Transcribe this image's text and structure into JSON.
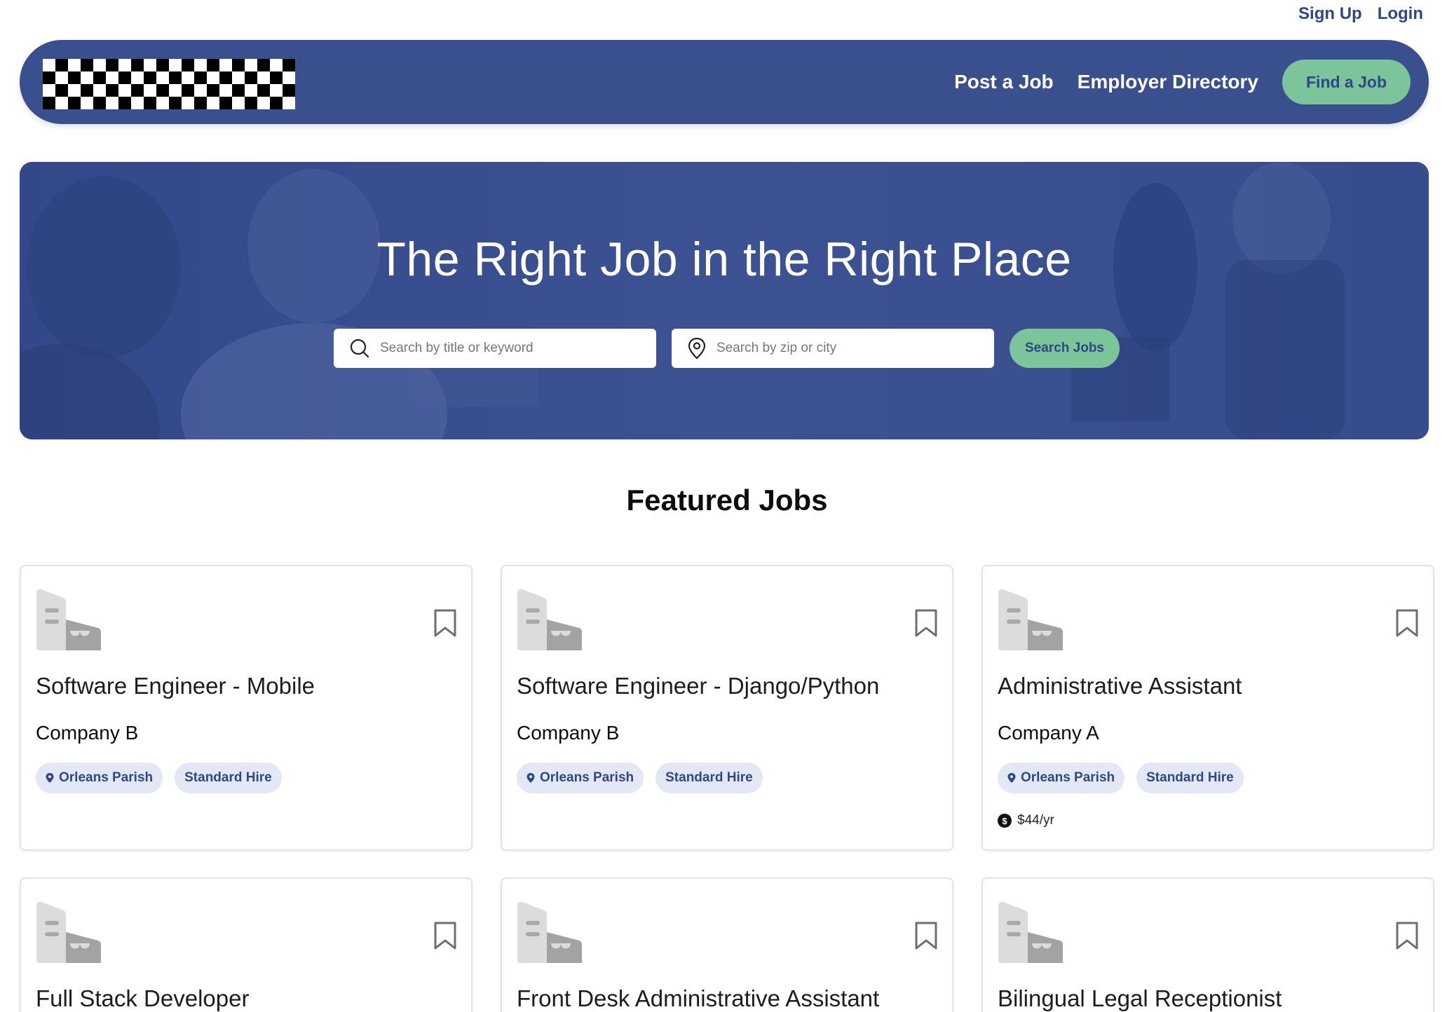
{
  "topbar": {
    "signup": "Sign Up",
    "login": "Login"
  },
  "nav": {
    "post_job": "Post a Job",
    "employer_directory": "Employer Directory",
    "find_job": "Find a Job"
  },
  "hero": {
    "title": "The Right Job in the Right Place",
    "keyword_placeholder": "Search by title or keyword",
    "location_placeholder": "Search by zip or city",
    "search_button": "Search Jobs"
  },
  "featured": {
    "title": "Featured Jobs",
    "jobs": [
      {
        "title": "Software Engineer - Mobile",
        "company": "Company B",
        "location": "Orleans Parish",
        "type": "Standard Hire",
        "salary": ""
      },
      {
        "title": "Software Engineer - Django/Python",
        "company": "Company B",
        "location": "Orleans Parish",
        "type": "Standard Hire",
        "salary": ""
      },
      {
        "title": "Administrative Assistant",
        "company": "Company A",
        "location": "Orleans Parish",
        "type": "Standard Hire",
        "salary": "$44/yr"
      },
      {
        "title": "Full Stack Developer"
      },
      {
        "title": "Front Desk Administrative Assistant"
      },
      {
        "title": "Bilingual Legal Receptionist"
      }
    ]
  },
  "colors": {
    "brand_blue": "#3a4f8d",
    "accent_green": "#7cc49a",
    "tag_bg": "#e3e8f4"
  }
}
